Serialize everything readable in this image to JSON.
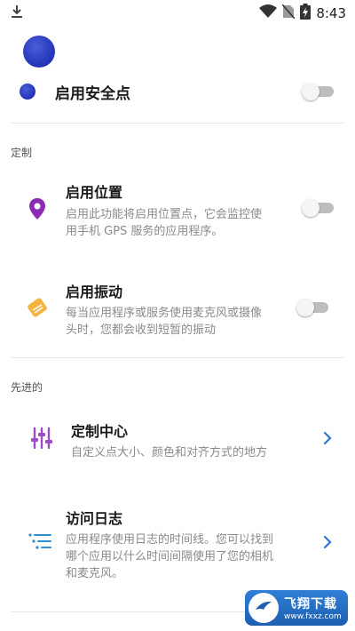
{
  "status_bar": {
    "time": "8:43"
  },
  "safe_point": {
    "label": "启用安全点",
    "enabled": false
  },
  "sections": {
    "customize": "定制",
    "advanced": "先进的"
  },
  "items": {
    "location": {
      "title": "启用位置",
      "desc_line1": "启用此功能将启用位置点，它会监控使",
      "desc_line2": "用手机 GPS 服务的应用程序。",
      "enabled": false
    },
    "vibration": {
      "title": "启用振动",
      "desc_line1": "每当应用程序或服务使用麦克风或摄像",
      "desc_line2": "头时，您都会收到短暂的振动",
      "enabled": false
    },
    "custom_center": {
      "title": "定制中心",
      "desc_line1": "自定义点大小、颜色和对齐方式的地方"
    },
    "access_log": {
      "title": "访问日志",
      "desc_line1": "应用程序使用日志的时间线。您可以找到",
      "desc_line2": "哪个应用以什么时间间隔使用了您的相机",
      "desc_line3": "和麦克风。"
    }
  },
  "watermark": {
    "line1": "飞翔下载",
    "line2": "www.fxxz.com"
  },
  "colors": {
    "location_icon": "#8e2bb4",
    "vibration_icon": "#f5b441",
    "custom_center_icon": "#9c4cc4",
    "access_log_icon": "#2e8fd6",
    "chevron": "#2e78d6"
  }
}
